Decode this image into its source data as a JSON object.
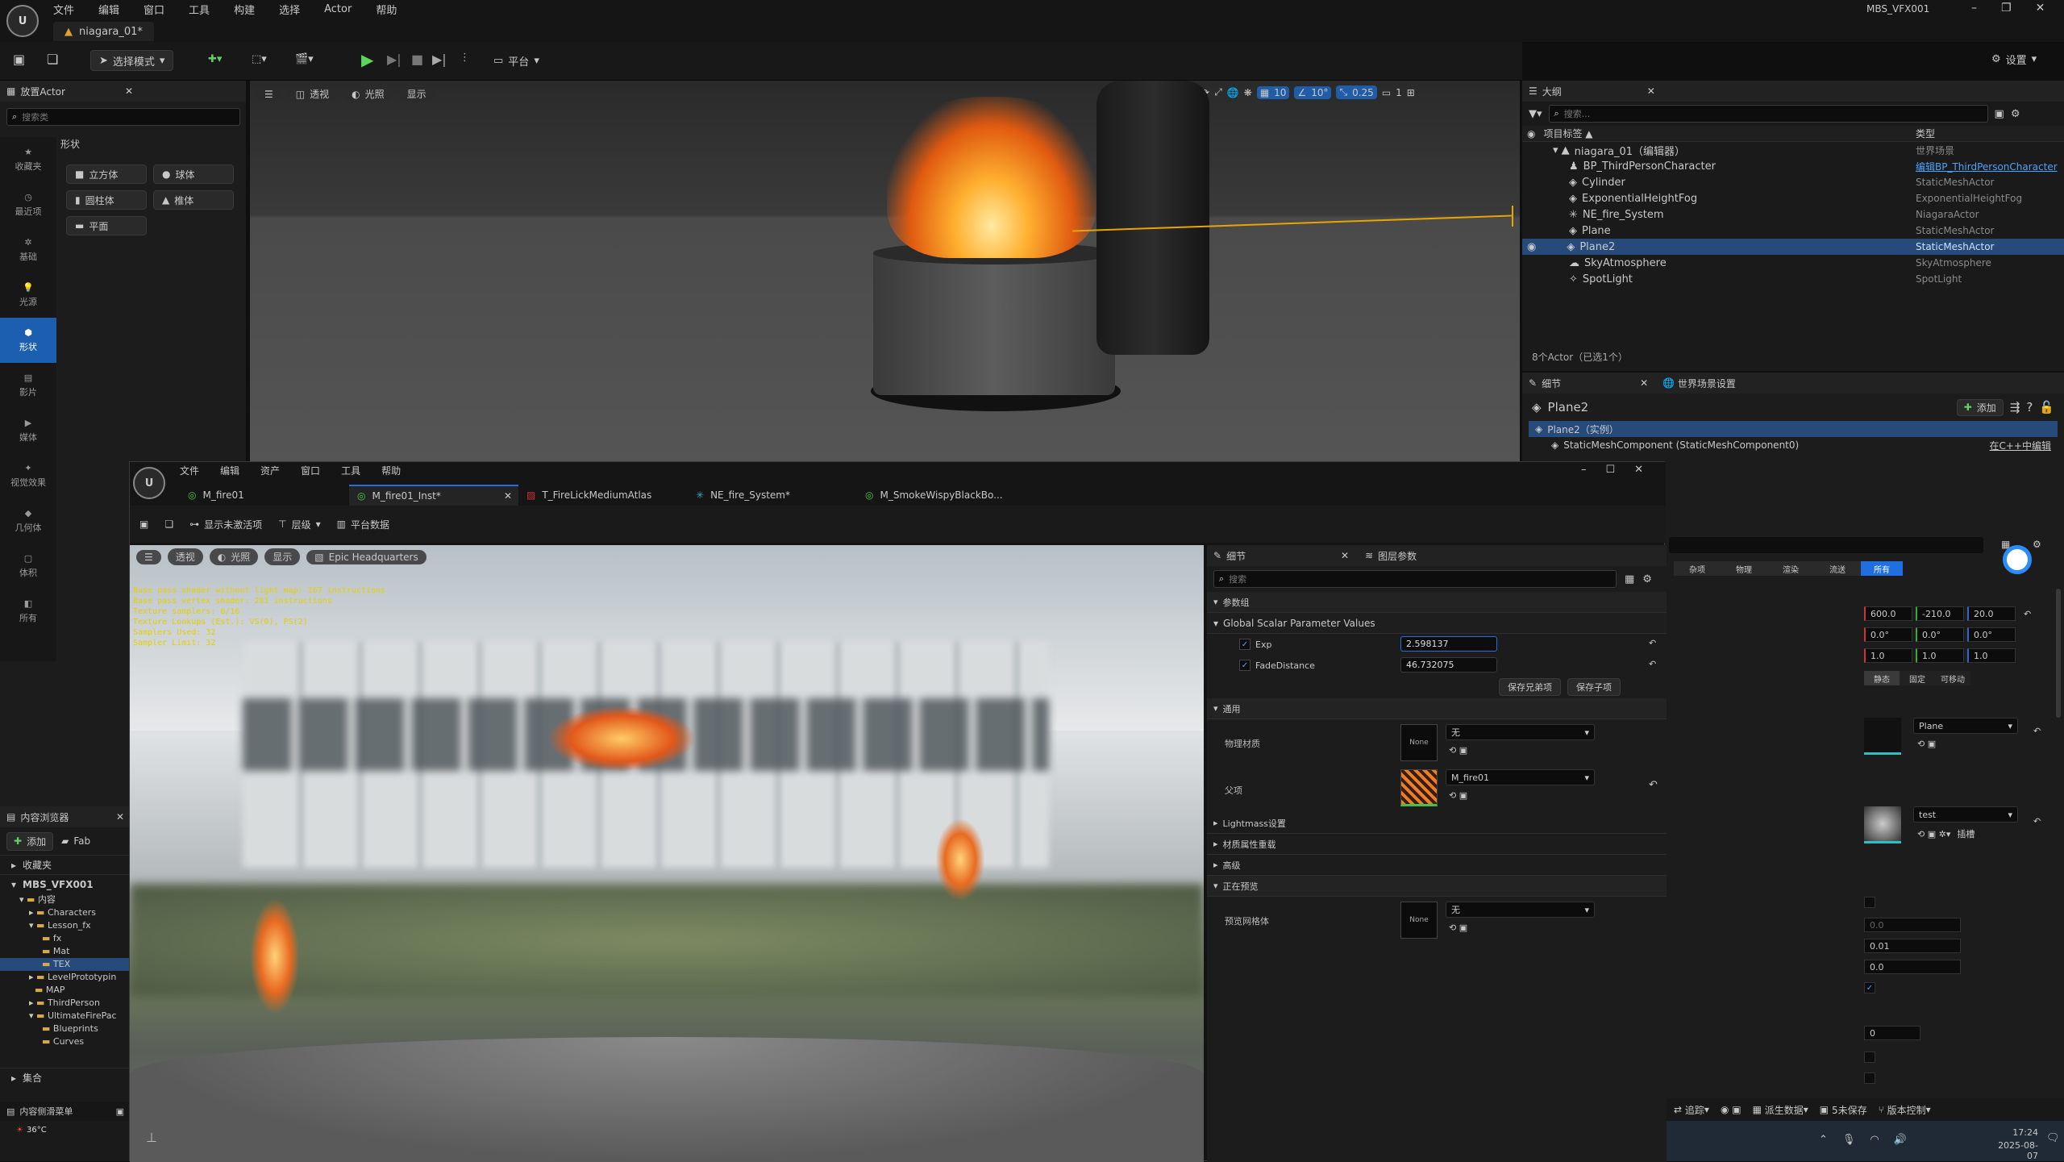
{
  "menubar": {
    "items": [
      "文件",
      "编辑",
      "窗口",
      "工具",
      "构建",
      "选择",
      "Actor",
      "帮助"
    ],
    "project": "MBS_VFX001",
    "level_tab": "niagara_01*"
  },
  "toolbar": {
    "mode": "选择模式",
    "platform": "平台",
    "settings": "设置"
  },
  "place_actors": {
    "title": "放置Actor",
    "search_placeholder": "搜索类",
    "category": "形状",
    "shapes": [
      "立方体",
      "球体",
      "圆柱体",
      "椎体",
      "平面"
    ],
    "nav": [
      "收藏夹",
      "最近项",
      "基础",
      "光源",
      "形状",
      "影片",
      "媒体",
      "视觉效果",
      "几何体",
      "体积",
      "所有"
    ]
  },
  "viewport1": {
    "view": "透视",
    "lit": "光照",
    "show": "显示",
    "grid": "10",
    "angle": "10°",
    "scale": "0.25",
    "cam": "1"
  },
  "outliner": {
    "title": "大纲",
    "search_placeholder": "搜索...",
    "col_label": "项目标签 ▲",
    "col_type": "类型",
    "rows": [
      {
        "label": "niagara_01（编辑器）",
        "type": "世界场景",
        "indent": 0
      },
      {
        "label": "BP_ThirdPersonCharacter",
        "type": "编辑BP_ThirdPersonCharacter",
        "indent": 1
      },
      {
        "label": "Cylinder",
        "type": "StaticMeshActor",
        "indent": 1
      },
      {
        "label": "ExponentialHeightFog",
        "type": "ExponentialHeightFog",
        "indent": 1
      },
      {
        "label": "NE_fire_System",
        "type": "NiagaraActor",
        "indent": 1
      },
      {
        "label": "Plane",
        "type": "StaticMeshActor",
        "indent": 1
      },
      {
        "label": "Plane2",
        "type": "StaticMeshActor",
        "indent": 1
      },
      {
        "label": "SkyAtmosphere",
        "type": "SkyAtmosphere",
        "indent": 1
      },
      {
        "label": "SpotLight",
        "type": "SpotLight",
        "indent": 1
      }
    ],
    "count": "8个Actor（已选1个）"
  },
  "details1": {
    "tab": "细节",
    "tab2": "世界场景设置",
    "name": "Plane2",
    "add": "添加",
    "instance": "Plane2（实例）",
    "component": "StaticMeshComponent (StaticMeshComponent0)",
    "cpp": "在C++中编辑",
    "filters": [
      "杂项",
      "物理",
      "渲染",
      "流送",
      "所有"
    ],
    "loc": [
      "600.0",
      "-210.0",
      "20.0"
    ],
    "rot": [
      "0.0°",
      "0.0°",
      "0.0°"
    ],
    "scl": [
      "1.0",
      "1.0",
      "1.0"
    ],
    "mob": [
      "静态",
      "固定",
      "可移动"
    ],
    "mesh": "Plane",
    "mat": "test",
    "mat_extra": "插槽",
    "vals": [
      "0.0",
      "0.01",
      "0.0",
      "0"
    ]
  },
  "content": {
    "title": "内容浏览器",
    "add": "添加",
    "fab": "Fab",
    "fav": "收藏夹",
    "root": "MBS_VFX001",
    "tree": [
      "内容",
      "Characters",
      "Lesson_fx",
      "fx",
      "Mat",
      "TEX",
      "LevelPrototypin",
      "MAP",
      "ThirdPerson",
      "UltimateFirePac",
      "Blueprints",
      "Curves"
    ],
    "collections": "集合",
    "drawer": "内容侧滑菜单"
  },
  "win2": {
    "menu": [
      "文件",
      "编辑",
      "资产",
      "窗口",
      "工具",
      "帮助"
    ],
    "tabs": [
      "M_fire01",
      "M_fire01_Inst*",
      "T_FireLickMediumAtlas",
      "NE_fire_System*",
      "M_SmokeWispyBlackBo..."
    ],
    "tools": [
      "显示未激活项",
      "层级",
      "平台数据"
    ],
    "vp": {
      "view": "透视",
      "lit": "光照",
      "show": "显示",
      "preview": "Epic Headquarters"
    },
    "stats": [
      "Base pass shader without light map: 167 instructions",
      "Base pass vertex shader: 281 instructions",
      "Texture samplers: 6/16",
      "Texture Lookups (Est.): VS(0), PS(2)",
      "Samplers Used: 32",
      "Sampler Limit: 32"
    ]
  },
  "details2": {
    "tab": "细节",
    "tab2": "图层参数",
    "search_placeholder": "搜索",
    "group": "参数组",
    "global": "Global Scalar Parameter Values",
    "params": [
      {
        "name": "Exp",
        "value": "2.598137"
      },
      {
        "name": "FadeDistance",
        "value": "46.732075"
      }
    ],
    "save_sib": "保存兄弟项",
    "save_child": "保存子项",
    "general": "通用",
    "phys": "物理材质",
    "phys_val": "无",
    "none": "None",
    "parent": "父项",
    "parent_val": "M_fire01",
    "lightmass": "Lightmass设置",
    "mat_overrides": "材质属性重载",
    "advanced": "高级",
    "preview_sec": "正在预览",
    "preview_mesh": "预览网格体",
    "preview_val": "无"
  },
  "status": {
    "trace": "追踪",
    "derive": "派生数据",
    "unsaved": "5未保存",
    "vc": "版本控制",
    "time": "17:24",
    "date": "2025-08-07",
    "temp": "36°C"
  }
}
